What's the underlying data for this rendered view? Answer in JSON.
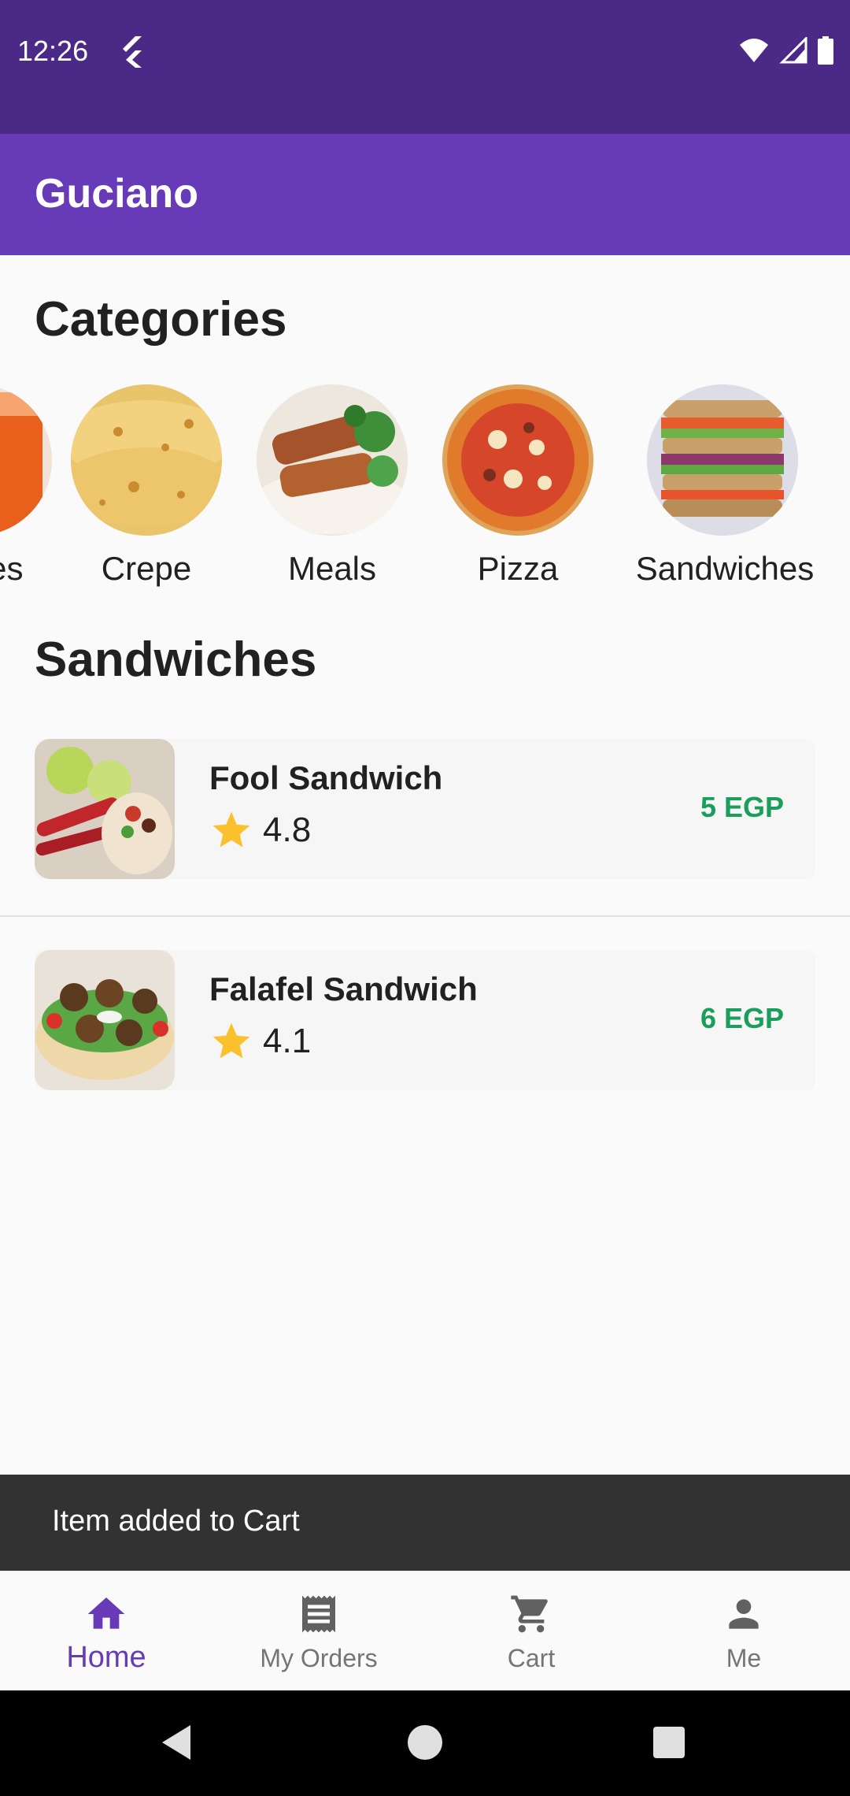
{
  "status_bar": {
    "time": "12:26"
  },
  "app_bar": {
    "title": "Guciano"
  },
  "categories": {
    "title": "Categories",
    "items": [
      {
        "label": "Juices",
        "icon": "juice-image"
      },
      {
        "label": "Crepe",
        "icon": "crepe-image"
      },
      {
        "label": "Meals",
        "icon": "meals-image"
      },
      {
        "label": "Pizza",
        "icon": "pizza-image"
      },
      {
        "label": "Sandwiches",
        "icon": "sandwiches-image"
      }
    ]
  },
  "section": {
    "title": "Sandwiches",
    "items": [
      {
        "name": "Fool Sandwich",
        "rating": "4.8",
        "price": "5 EGP",
        "image": "fool-sandwich-image"
      },
      {
        "name": "Falafel Sandwich",
        "rating": "4.1",
        "price": "6 EGP",
        "image": "falafel-sandwich-image"
      }
    ]
  },
  "snackbar": {
    "message": "Item added to Cart"
  },
  "bottom_nav": {
    "items": [
      {
        "label": "Home",
        "icon": "home-icon",
        "active": true
      },
      {
        "label": "My Orders",
        "icon": "receipt-icon",
        "active": false
      },
      {
        "label": "Cart",
        "icon": "cart-icon",
        "active": false
      },
      {
        "label": "Me",
        "icon": "person-icon",
        "active": false
      }
    ]
  },
  "colors": {
    "status_bar": "#4B2A87",
    "app_bar": "#673AB7",
    "price": "#1A9E5B",
    "star": "#FBC02D",
    "snackbar": "#323232"
  }
}
